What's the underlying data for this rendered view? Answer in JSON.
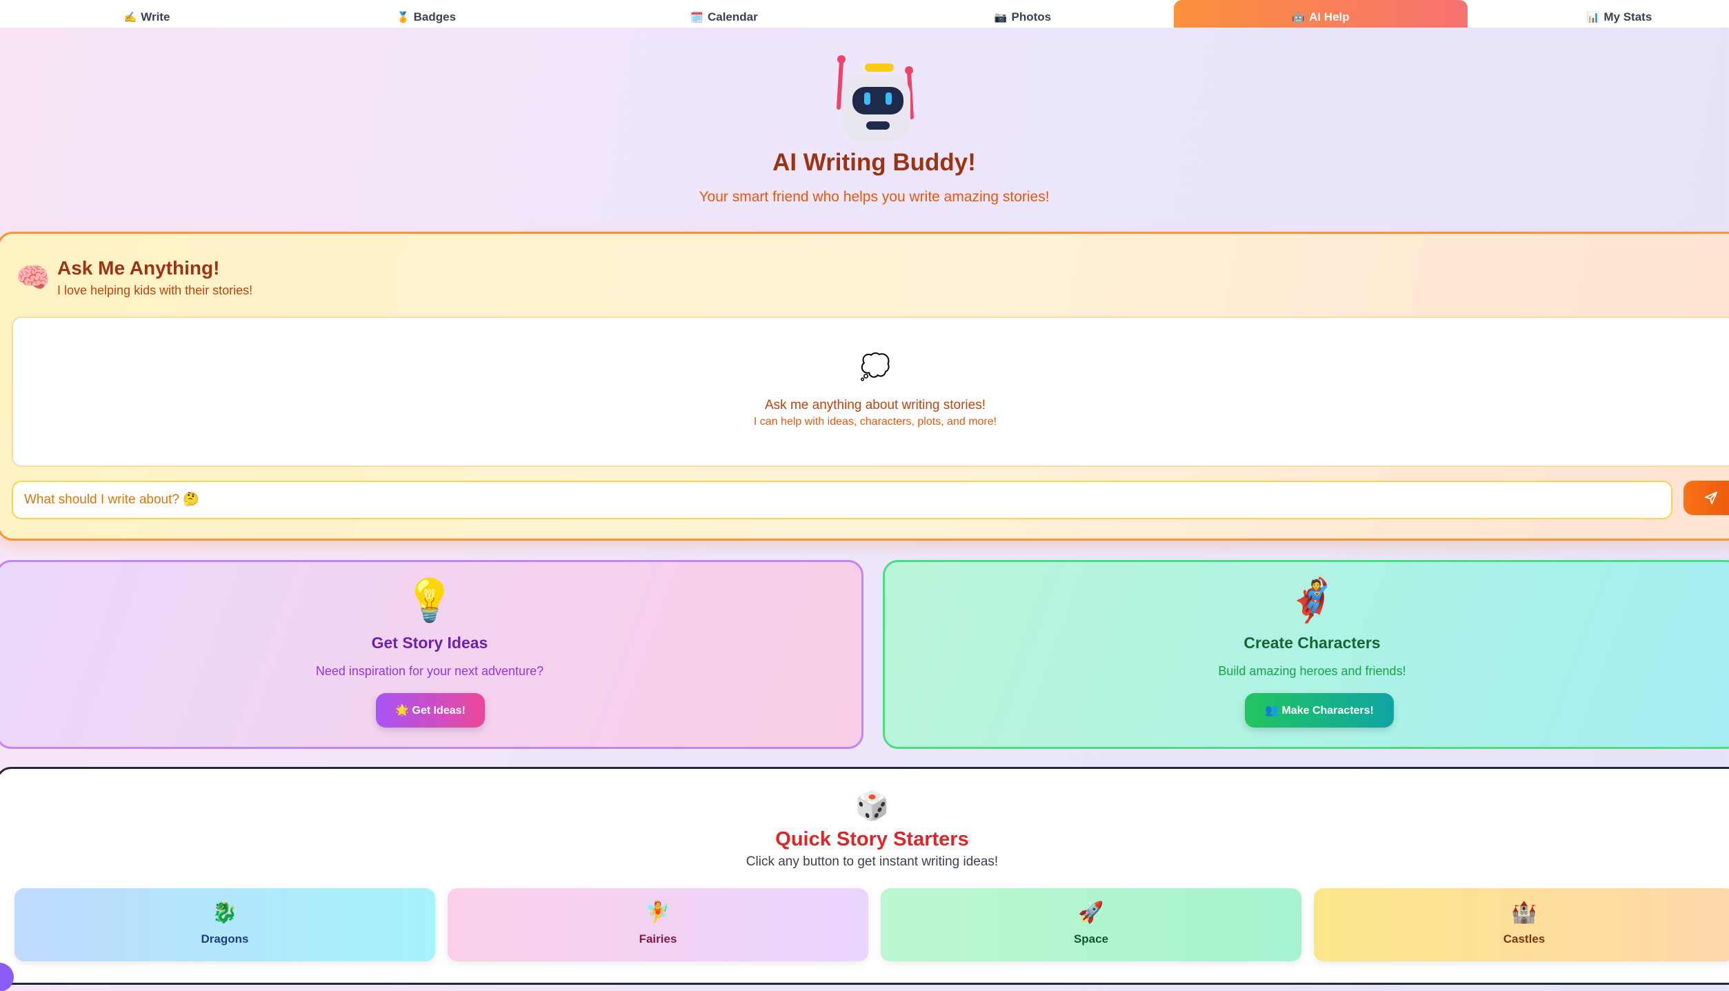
{
  "tabs": [
    {
      "icon": "✍️",
      "label": "Write"
    },
    {
      "icon": "🏅",
      "label": "Badges"
    },
    {
      "icon": "🗓️",
      "label": "Calendar"
    },
    {
      "icon": "📷",
      "label": "Photos"
    },
    {
      "icon": "🤖",
      "label": "AI Help"
    },
    {
      "icon": "📊",
      "label": "My Stats"
    }
  ],
  "active_tab": "AI Help",
  "header": {
    "title": "AI Writing Buddy!",
    "subtitle": "Your smart friend who helps you write amazing stories!"
  },
  "ask": {
    "icon": "🧠",
    "title": "Ask Me Anything!",
    "subtitle": "I love helping kids with their stories!",
    "empty_icon": "💭",
    "empty_title": "Ask me anything about writing stories!",
    "empty_hint": "I can help with ideas, characters, plots, and more!",
    "placeholder": "What should I write about? 🤔",
    "send_icon": "paper-plane-icon"
  },
  "cards": {
    "ideas": {
      "icon": "💡",
      "title": "Get Story Ideas",
      "subtitle": "Need inspiration for your next adventure?",
      "button": "🌟 Get Ideas!"
    },
    "characters": {
      "icon": "🦸",
      "title": "Create Characters",
      "subtitle": "Build amazing heroes and friends!",
      "button": "👥 Make Characters!"
    }
  },
  "starters": {
    "icon": "🎲",
    "title": "Quick Story Starters",
    "subtitle": "Click any button to get instant writing ideas!",
    "items": [
      {
        "icon": "🐉",
        "label": "Dragons"
      },
      {
        "icon": "🧚",
        "label": "Fairies"
      },
      {
        "icon": "🚀",
        "label": "Space"
      },
      {
        "icon": "🏰",
        "label": "Castles"
      }
    ]
  },
  "colors": {
    "accent_orange": "#fb923c",
    "title_brown": "#9a3412",
    "purple": "#a855f7",
    "green": "#22c55e",
    "starter_red": "#dc2626"
  }
}
